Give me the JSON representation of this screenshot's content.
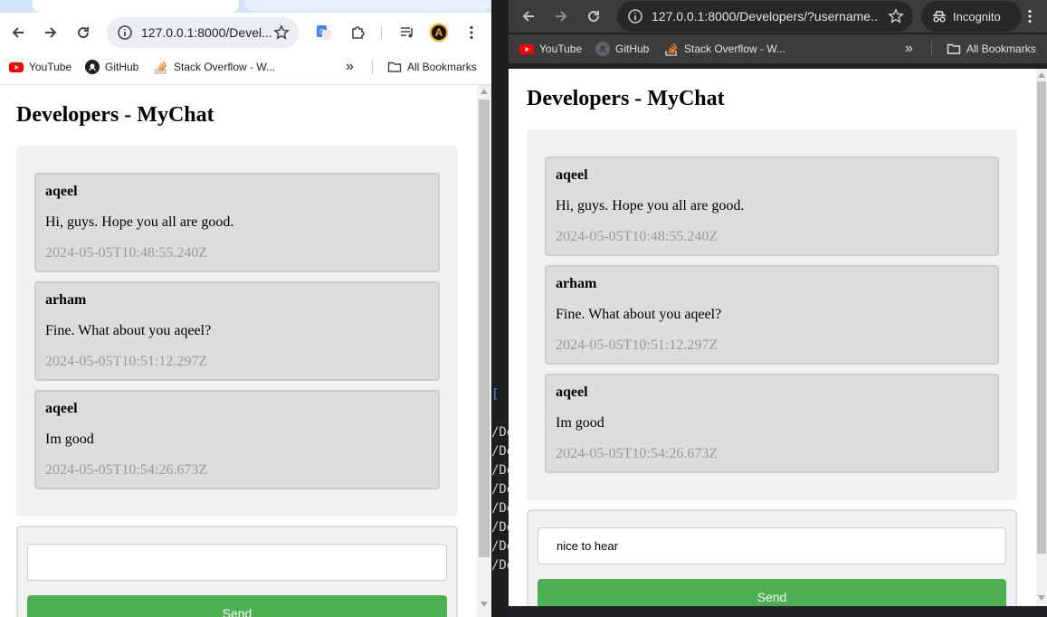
{
  "terminal": {
    "lines": [
      "[",
      "/De",
      "/De",
      "/De",
      "/De",
      "/De",
      "/De",
      "/De",
      "/De"
    ]
  },
  "left_window": {
    "omnibox": {
      "url": "127.0.0.1:8000/Devel..."
    },
    "toolbar_icons": [
      "back-icon",
      "forward-icon",
      "reload-icon",
      "site-info-icon",
      "star-icon",
      "google-translate-icon",
      "extensions-icon",
      "media-control-icon",
      "profile-avatar-icon",
      "menu-icon"
    ],
    "profile_initial": "A",
    "bookmarks": [
      {
        "label": "YouTube",
        "icon": "youtube-icon"
      },
      {
        "label": "GitHub",
        "icon": "github-icon"
      },
      {
        "label": "Stack Overflow - W...",
        "icon": "stackoverflow-icon"
      }
    ],
    "overflow_label": "»",
    "all_bookmarks": "All Bookmarks",
    "page": {
      "title": "Developers - MyChat",
      "messages": [
        {
          "user": "aqeel",
          "text": "Hi, guys. Hope you all are good.",
          "time": "2024-05-05T10:48:55.240Z"
        },
        {
          "user": "arham",
          "text": "Fine. What about you aqeel?",
          "time": "2024-05-05T10:51:12.297Z"
        },
        {
          "user": "aqeel",
          "text": "Im good",
          "time": "2024-05-05T10:54:26.673Z"
        }
      ],
      "input_value": "",
      "send_label": "Send"
    }
  },
  "right_window": {
    "omnibox": {
      "url": "127.0.0.1:8000/Developers/?username..."
    },
    "incognito_label": "Incognito",
    "bookmarks": [
      {
        "label": "YouTube",
        "icon": "youtube-icon"
      },
      {
        "label": "GitHub",
        "icon": "github-icon"
      },
      {
        "label": "Stack Overflow - W...",
        "icon": "stackoverflow-icon"
      }
    ],
    "overflow_label": "»",
    "all_bookmarks": "All Bookmarks",
    "page": {
      "title": "Developers - MyChat",
      "messages": [
        {
          "user": "aqeel",
          "text": "Hi, guys. Hope you all are good.",
          "time": "2024-05-05T10:48:55.240Z"
        },
        {
          "user": "arham",
          "text": "Fine. What about you aqeel?",
          "time": "2024-05-05T10:51:12.297Z"
        },
        {
          "user": "aqeel",
          "text": "Im good",
          "time": "2024-05-05T10:54:26.673Z"
        }
      ],
      "input_value": "nice to hear",
      "send_label": "Send"
    }
  },
  "colors": {
    "send_button": "#4caf50",
    "chat_box": "#f1f1f1",
    "message_bg": "#dddddd",
    "timestamp": "#999999",
    "incognito_toolbar": "#3c3c3c",
    "incognito_frame": "#202124"
  }
}
